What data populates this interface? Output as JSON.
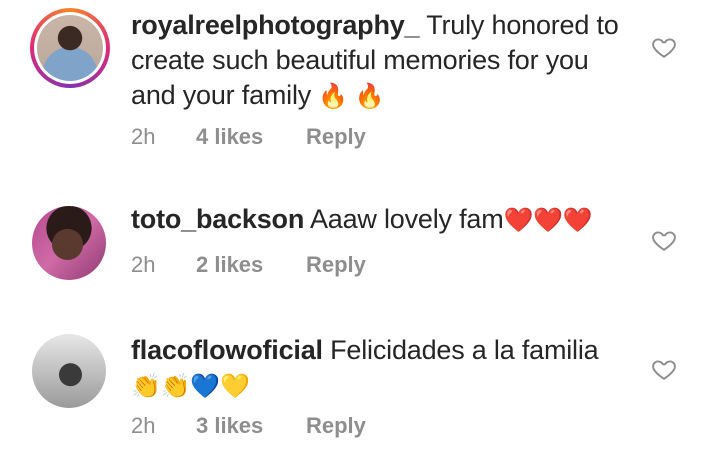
{
  "comments": [
    {
      "username": "royalreelphotography_",
      "text": "Truly honored to create such beautiful memories for you and your family",
      "emojis": "🔥 🔥",
      "time": "2h",
      "likes": "4 likes",
      "reply": "Reply",
      "has_story_ring": true
    },
    {
      "username": "toto_backson",
      "text": "Aaaw lovely fam",
      "emojis": "❤️❤️❤️",
      "time": "2h",
      "likes": "2 likes",
      "reply": "Reply",
      "has_story_ring": false
    },
    {
      "username": "flacoflowoficial",
      "text": "Felicidades a la familia",
      "emojis": "👏👏💙💛",
      "time": "2h",
      "likes": "3 likes",
      "reply": "Reply",
      "has_story_ring": false
    }
  ],
  "icons": {
    "like": "heart-outline-icon"
  },
  "colors": {
    "meta": "#8e8e8e",
    "text": "#262626",
    "ring_start": "#f58529",
    "ring_end": "#8134af"
  }
}
